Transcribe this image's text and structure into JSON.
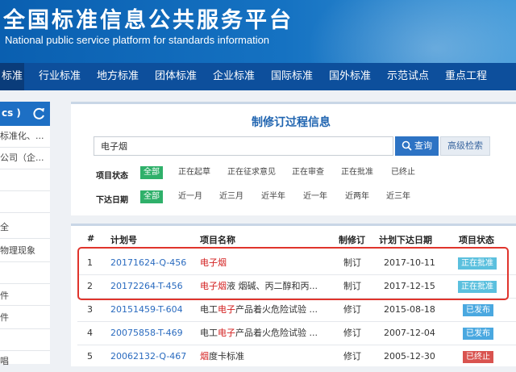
{
  "banner": {
    "title_cn": "全国标准信息公共服务平台",
    "title_en": "National public service platform  for standards information"
  },
  "nav": {
    "items": [
      "标准",
      "行业标准",
      "地方标准",
      "团体标准",
      "企业标准",
      "国际标准",
      "国外标准",
      "示范试点",
      "重点工程"
    ]
  },
  "sidebar": {
    "head": "cs )",
    "rows": [
      "标准化、...",
      "公司（企...",
      "",
      "",
      "全",
      "物理现象",
      "",
      "",
      "件",
      "件",
      "",
      "唱"
    ]
  },
  "search": {
    "title": "制修订过程信息",
    "query": "电子烟",
    "search_label": "查询",
    "advanced_label": "高级检索"
  },
  "filters": {
    "status": {
      "label": "项目状态",
      "options": [
        "全部",
        "正在起草",
        "正在征求意见",
        "正在审查",
        "正在批准",
        "已终止"
      ],
      "selected": "全部"
    },
    "date": {
      "label": "下达日期",
      "options": [
        "全部",
        "近一月",
        "近三月",
        "近半年",
        "近一年",
        "近两年",
        "近三年"
      ],
      "selected": "全部"
    }
  },
  "table": {
    "headers": [
      "#",
      "计划号",
      "项目名称",
      "制修订",
      "计划下达日期",
      "项目状态"
    ],
    "rows": [
      {
        "num": "1",
        "code": "20171624-Q-456",
        "name_pre": "",
        "name_hl": "电子烟",
        "name_post": "",
        "type": "制订",
        "date": "2017-10-11",
        "status": "正在批准",
        "status_color": "#5bc0de"
      },
      {
        "num": "2",
        "code": "20172264-T-456",
        "name_pre": "",
        "name_hl": "电子烟",
        "name_post": "液 烟碱、丙二醇和丙...",
        "type": "制订",
        "date": "2017-12-15",
        "status": "正在批准",
        "status_color": "#5bc0de"
      },
      {
        "num": "3",
        "code": "20151459-T-604",
        "name_pre": "电工",
        "name_hl": "电子",
        "name_post": "产品着火危险试验 ...",
        "type": "修订",
        "date": "2015-08-18",
        "status": "已发布",
        "status_color": "#4aa8e0"
      },
      {
        "num": "4",
        "code": "20075858-T-469",
        "name_pre": "电工",
        "name_hl": "电子",
        "name_post": "产品着火危险试验 ...",
        "type": "修订",
        "date": "2007-12-04",
        "status": "已发布",
        "status_color": "#4aa8e0"
      },
      {
        "num": "5",
        "code": "20062132-Q-467",
        "name_pre": "",
        "name_hl": "烟",
        "name_post": "度卡标准",
        "type": "修订",
        "date": "2005-12-30",
        "status": "已终止",
        "status_color": "#d9534f"
      }
    ]
  },
  "colors": {
    "brand_blue": "#1572c2",
    "nav_blue": "#0d4f9c",
    "selected_green": "#2fb06a",
    "highlight_red": "#e0342c"
  }
}
